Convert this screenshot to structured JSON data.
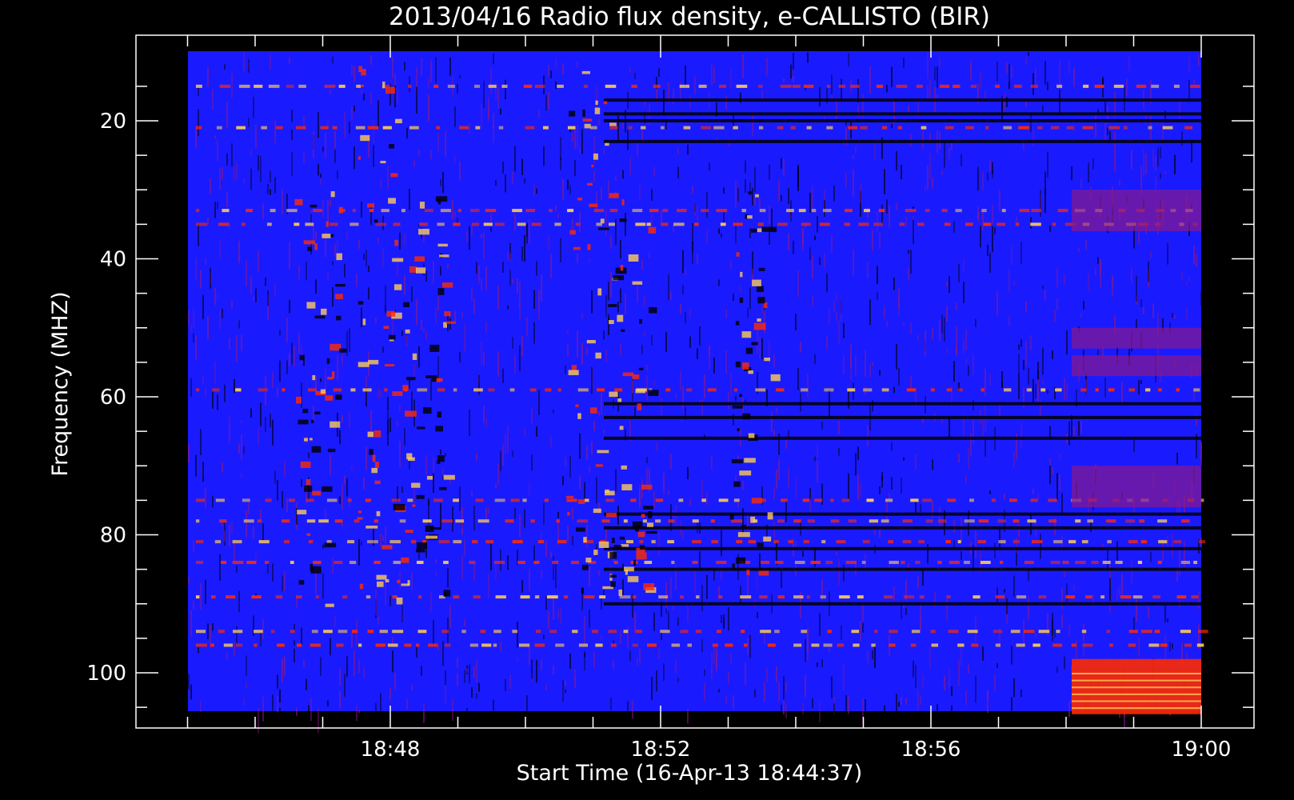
{
  "chart_data": {
    "type": "heatmap",
    "title": "2013/04/16  Radio flux density, e-CALLISTO (BIR)",
    "xlabel": "Start Time (16-Apr-13 18:44:37)",
    "ylabel": "Frequency (MHZ)",
    "x_ticks": [
      "18:48",
      "18:52",
      "18:56",
      "19:00"
    ],
    "y_ticks": [
      "20",
      "40",
      "60",
      "80",
      "100"
    ],
    "x_range": [
      "18:44:37",
      "19:00:00"
    ],
    "y_range_mhz": [
      10,
      107
    ],
    "y_axis_inverted": true,
    "colormap": [
      "#000000",
      "#1a1aff",
      "#8a1a8a",
      "#ff2a00",
      "#ffcc55"
    ],
    "background_level": "#1a1aff",
    "bursts": [
      {
        "t": "18:47:50",
        "f_lo": 12,
        "f_hi": 92,
        "intensity": 0.9
      },
      {
        "t": "18:46:55",
        "f_lo": 30,
        "f_hi": 90,
        "intensity": 0.6
      },
      {
        "t": "18:48:30",
        "f_lo": 30,
        "f_hi": 90,
        "intensity": 0.55
      },
      {
        "t": "18:50:55",
        "f_lo": 12,
        "f_hi": 90,
        "intensity": 0.8
      },
      {
        "t": "18:51:30",
        "f_lo": 30,
        "f_hi": 88,
        "intensity": 0.5
      },
      {
        "t": "18:53:20",
        "f_lo": 30,
        "f_hi": 86,
        "intensity": 0.4
      }
    ],
    "emission_lines_mhz": [
      15,
      21,
      33,
      35,
      59,
      75,
      78,
      81,
      84,
      89,
      94,
      96
    ],
    "dark_lines_mhz": [
      17,
      19,
      20,
      23,
      61,
      63,
      66,
      77,
      79,
      82,
      85,
      90
    ],
    "high_level_region": {
      "t_start": "18:58:05",
      "t_end": "19:00:00",
      "f_lo": 98,
      "f_hi": 106
    }
  }
}
